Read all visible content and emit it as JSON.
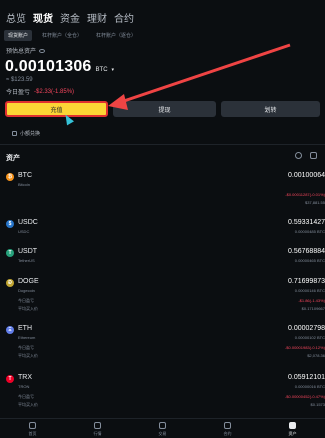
{
  "top_tabs": [
    {
      "label": "总览",
      "active": false
    },
    {
      "label": "现货",
      "active": true
    },
    {
      "label": "资金",
      "active": false
    },
    {
      "label": "理财",
      "active": false
    },
    {
      "label": "合约",
      "active": false
    }
  ],
  "sub_tabs": [
    {
      "label": "现货账户",
      "active": true
    },
    {
      "label": "杠杆账户（全仓）",
      "active": false
    },
    {
      "label": "杠杆账户（逐仓）",
      "active": false
    }
  ],
  "balance": {
    "label": "预估总资产",
    "value": "0.00101306",
    "unit": "BTC",
    "fiat": "≈ $123.59",
    "pnl_label": "今日盈亏",
    "pnl_value": "-$2.33(-1.85%)"
  },
  "actions": {
    "deposit": "充值",
    "withdraw": "提现",
    "transfer": "划转"
  },
  "small_assets_label": "小额兑换",
  "assets_title": "资产",
  "assets": [
    {
      "symbol": "BTC",
      "name": "Bitcoin",
      "color": "#f7931a",
      "amount": "0.00100064",
      "pnl": "-$0.00011287(-0.01%)",
      "avg": "$37,881.55",
      "pnl_neg": true
    },
    {
      "symbol": "USDC",
      "name": "USDC",
      "color": "#2775ca",
      "amount": "0.59331427",
      "sub": "0.00000485 BTC"
    },
    {
      "symbol": "USDT",
      "name": "TetherUS",
      "color": "#26a17b",
      "amount": "0.56768884",
      "sub": "0.00000465 BTC"
    },
    {
      "symbol": "DOGE",
      "name": "Dogecoin",
      "color": "#c2a633",
      "amount": "0.71699873",
      "sub": "0.00000146 BTC",
      "pnl": "-$1.86(-1.43%)",
      "avg": "$0.17109667",
      "pnl_neg": true
    },
    {
      "symbol": "ETH",
      "name": "Ethereum",
      "color": "#627eea",
      "amount": "0.00002798",
      "sub": "0.00000102 BTC",
      "pnl": "-$0.00001983(-0.12%)",
      "avg": "$2,078.36",
      "pnl_neg": true
    },
    {
      "symbol": "TRX",
      "name": "TRON",
      "color": "#ef0027",
      "amount": "0.05912101",
      "sub": "0.00000016 BTC",
      "pnl": "-$0.00000452(-0.47%)",
      "avg": "$0.1573",
      "pnl_neg": true
    }
  ],
  "row_labels": {
    "today_pnl": "今日盈亏",
    "avg_price": "平均买入价"
  },
  "bottom_nav": [
    {
      "label": "首页",
      "active": false
    },
    {
      "label": "行情",
      "active": false
    },
    {
      "label": "交易",
      "active": false
    },
    {
      "label": "合约",
      "active": false
    },
    {
      "label": "资产",
      "active": true
    }
  ]
}
